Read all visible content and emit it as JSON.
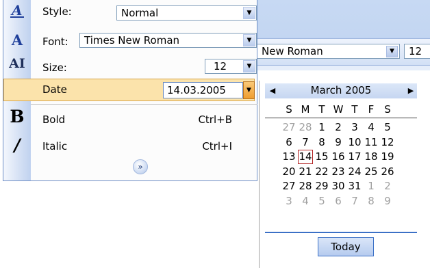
{
  "background_toolbar": {
    "font_value": "New Roman",
    "size_value": "12"
  },
  "panel": {
    "style": {
      "label": "Style:",
      "value": "Normal",
      "icon": "style-icon"
    },
    "font": {
      "label": "Font:",
      "value": "Times New Roman",
      "icon": "font-icon"
    },
    "size": {
      "label": "Size:",
      "value": "12",
      "icon": "font-size-icon"
    },
    "date": {
      "label": "Date",
      "value": "14.03.2005"
    },
    "bold": {
      "label": "Bold",
      "shortcut": "Ctrl+B",
      "icon": "bold-icon"
    },
    "italic": {
      "label": "Italic",
      "shortcut": "Ctrl+I",
      "icon": "italic-icon"
    },
    "expand_icon": "double-chevron-down-icon"
  },
  "calendar": {
    "title": "March 2005",
    "days_of_week": [
      "S",
      "M",
      "T",
      "W",
      "T",
      "F",
      "S"
    ],
    "weeks": [
      [
        "27",
        "28",
        "1",
        "2",
        "3",
        "4",
        "5"
      ],
      [
        "6",
        "7",
        "8",
        "9",
        "10",
        "11",
        "12"
      ],
      [
        "13",
        "14",
        "15",
        "16",
        "17",
        "18",
        "19"
      ],
      [
        "20",
        "21",
        "22",
        "23",
        "24",
        "25",
        "26"
      ],
      [
        "27",
        "28",
        "29",
        "30",
        "31",
        "1",
        "2"
      ],
      [
        "3",
        "4",
        "5",
        "6",
        "7",
        "8",
        "9"
      ]
    ],
    "today_label": "Today"
  },
  "colors": {
    "highlight": "#fbe3ab",
    "accent": "#3b70c6",
    "today_border": "#b22222"
  }
}
